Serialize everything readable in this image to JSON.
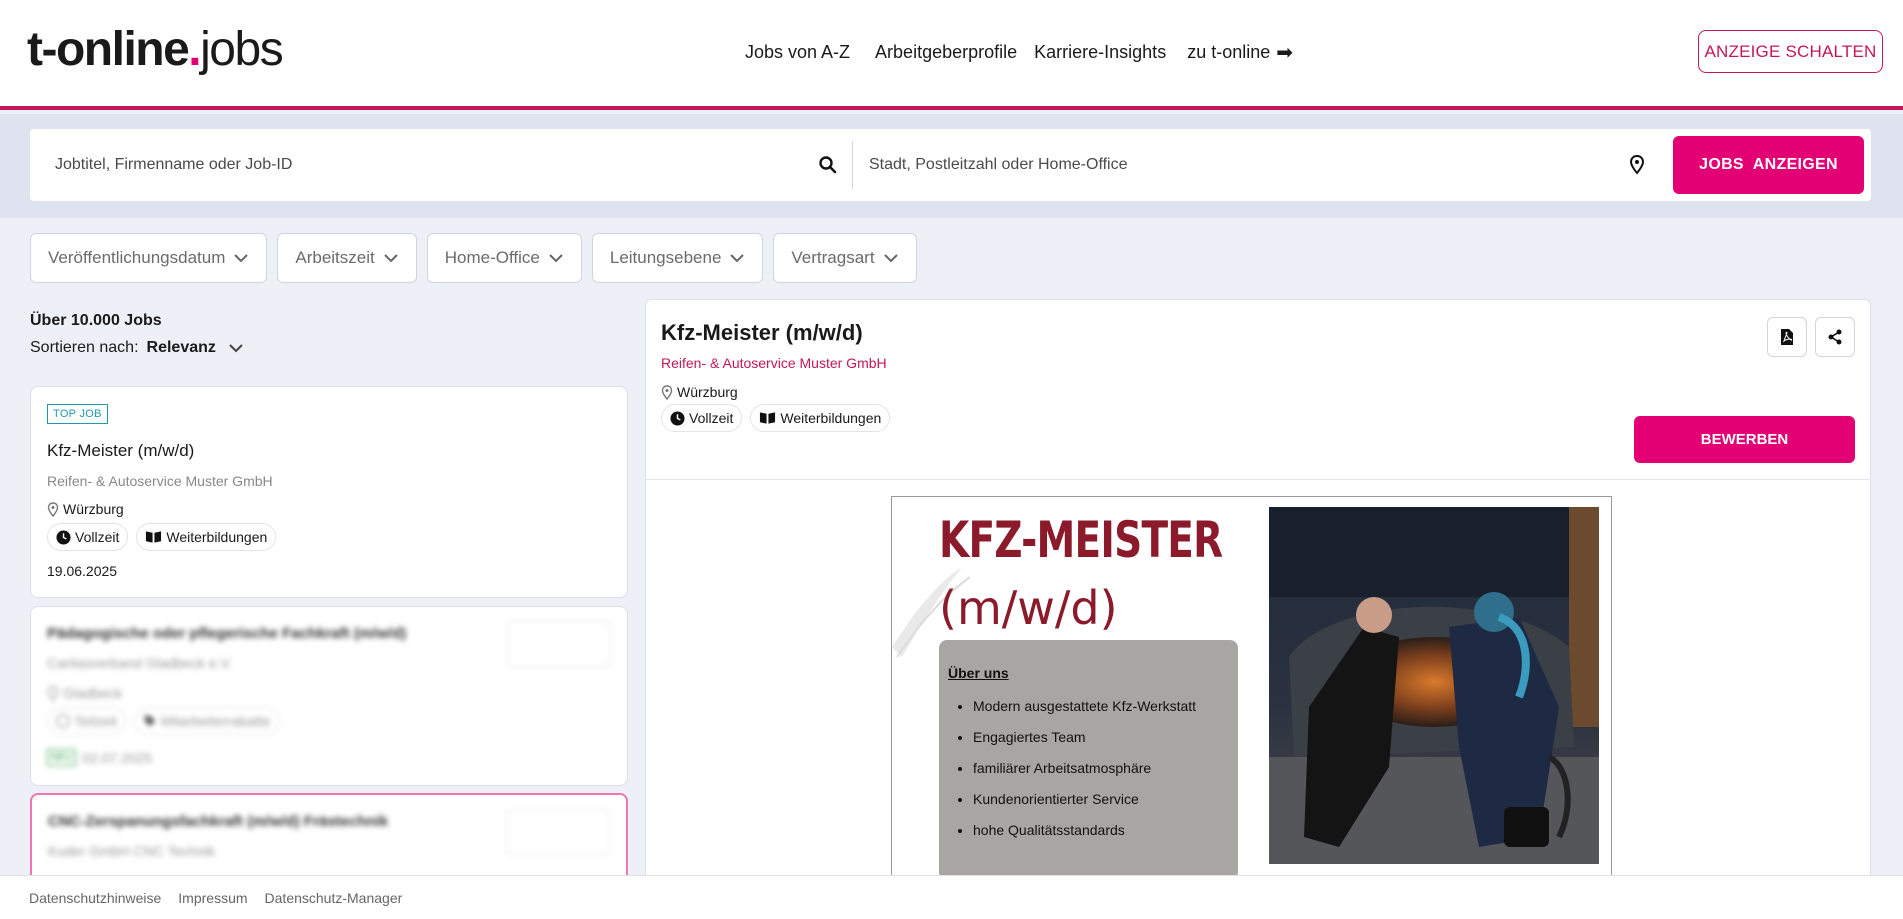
{
  "header": {
    "logo_brand": "t-online",
    "logo_dot": ".",
    "logo_product": "jobs",
    "nav": [
      "Jobs von A-Z",
      "Arbeitgeberprofile",
      "Karriere-Insights",
      "zu t-online"
    ],
    "cta": "ANZEIGE SCHALTEN"
  },
  "search": {
    "job_placeholder": "Jobtitel, Firmenname oder Job-ID",
    "location_placeholder": "Stadt, Postleitzahl oder Home-Office",
    "submit": "JOBS  ANZEIGEN"
  },
  "filters": [
    "Veröffentlichungsdatum",
    "Arbeitszeit",
    "Home-Office",
    "Leitungsebene",
    "Vertragsart"
  ],
  "results": {
    "count_prefix": "Über",
    "count": "10.000",
    "count_suffix": "Jobs",
    "sort_label": "Sortieren nach:",
    "sort_value": "Relevanz"
  },
  "cards": [
    {
      "badge": "TOP JOB",
      "title": "Kfz-Meister (m/w/d)",
      "company": "Reifen- & Autoservice Muster GmbH",
      "location": "Würzburg",
      "chips": [
        "Vollzeit",
        "Weiterbildungen"
      ],
      "date": "19.06.2025"
    },
    {
      "title": "Pädagogische oder pflegerische Fachkraft (m/w/d)",
      "company": "Caritasverband Gladbeck e.V.",
      "location": "Gladbeck",
      "chips": [
        "Teilzeit",
        "Mitarbeiterrabatte"
      ],
      "new_badge": "NEU",
      "date": "02.07.2025"
    },
    {
      "title": "CNC-Zerspanungsfachkraft (m/w/d) Frästechnik",
      "company": "Kuder GmbH CNC Technik"
    }
  ],
  "detail": {
    "title": "Kfz-Meister (m/w/d)",
    "company": "Reifen- & Autoservice Muster GmbH",
    "location": "Würzburg",
    "chips": [
      "Vollzeit",
      "Weiterbildungen"
    ],
    "apply": "BEWERBEN",
    "ad": {
      "title_line1": "KFZ-MEISTER",
      "title_line2": "(m/w/d)",
      "about_heading": "Über uns",
      "about_items": [
        "Modern ausgestattete Kfz-Werkstatt",
        "Engagiertes Team",
        "familiärer Arbeitsatmosphäre",
        "Kundenorientierter Service",
        "hohe Qualitätsstandards"
      ]
    }
  },
  "footer": [
    "Datenschutzhinweise",
    "Impressum",
    "Datenschutz-Manager"
  ],
  "colors": {
    "accent": "#e20074",
    "accent_dark": "#c2185b",
    "top_badge": "#1f9bb0",
    "ad_title": "#8b1a2b"
  }
}
